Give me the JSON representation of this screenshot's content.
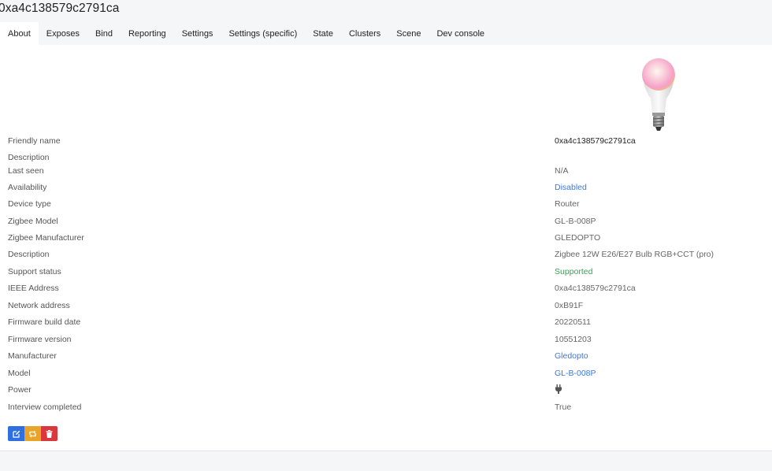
{
  "device_title": "0xa4c138579c2791ca",
  "tabs": [
    {
      "label": "About"
    },
    {
      "label": "Exposes"
    },
    {
      "label": "Bind"
    },
    {
      "label": "Reporting"
    },
    {
      "label": "Settings"
    },
    {
      "label": "Settings (specific)"
    },
    {
      "label": "State"
    },
    {
      "label": "Clusters"
    },
    {
      "label": "Scene"
    },
    {
      "label": "Dev console"
    }
  ],
  "active_tab": "About",
  "details": [
    {
      "label": "Friendly name",
      "value": "0xa4c138579c2791ca"
    },
    {
      "label": "Description",
      "value": ""
    },
    {
      "label": "Last seen",
      "value": "N/A"
    },
    {
      "label": "Availability",
      "value": "Disabled"
    },
    {
      "label": "Device type",
      "value": "Router"
    },
    {
      "label": "Zigbee Model",
      "value": "GL-B-008P"
    },
    {
      "label": "Zigbee Manufacturer",
      "value": "GLEDOPTO"
    },
    {
      "label": "Description",
      "value": "Zigbee 12W E26/E27 Bulb RGB+CCT (pro)"
    },
    {
      "label": "Support status",
      "value": "Supported"
    },
    {
      "label": "IEEE Address",
      "value": "0xa4c138579c2791ca"
    },
    {
      "label": "Network address",
      "value": "0xB91F"
    },
    {
      "label": "Firmware build date",
      "value": "20220511"
    },
    {
      "label": "Firmware version",
      "value": "10551203"
    },
    {
      "label": "Manufacturer",
      "value": "Gledopto"
    },
    {
      "label": "Model",
      "value": "GL-B-008P"
    },
    {
      "label": "Power",
      "value": "",
      "icon": "plug-icon"
    },
    {
      "label": "Interview completed",
      "value": "True"
    }
  ],
  "icons": {
    "device_image": "light-bulb-image",
    "actions": [
      "edit-icon",
      "reconfigure-icon",
      "trash-icon"
    ]
  },
  "colors": {
    "link": "#3d78d8",
    "supported": "#2fa84f",
    "edit": "#2f6fe0",
    "reconfigure": "#e9a42a",
    "remove": "#d9393d"
  }
}
